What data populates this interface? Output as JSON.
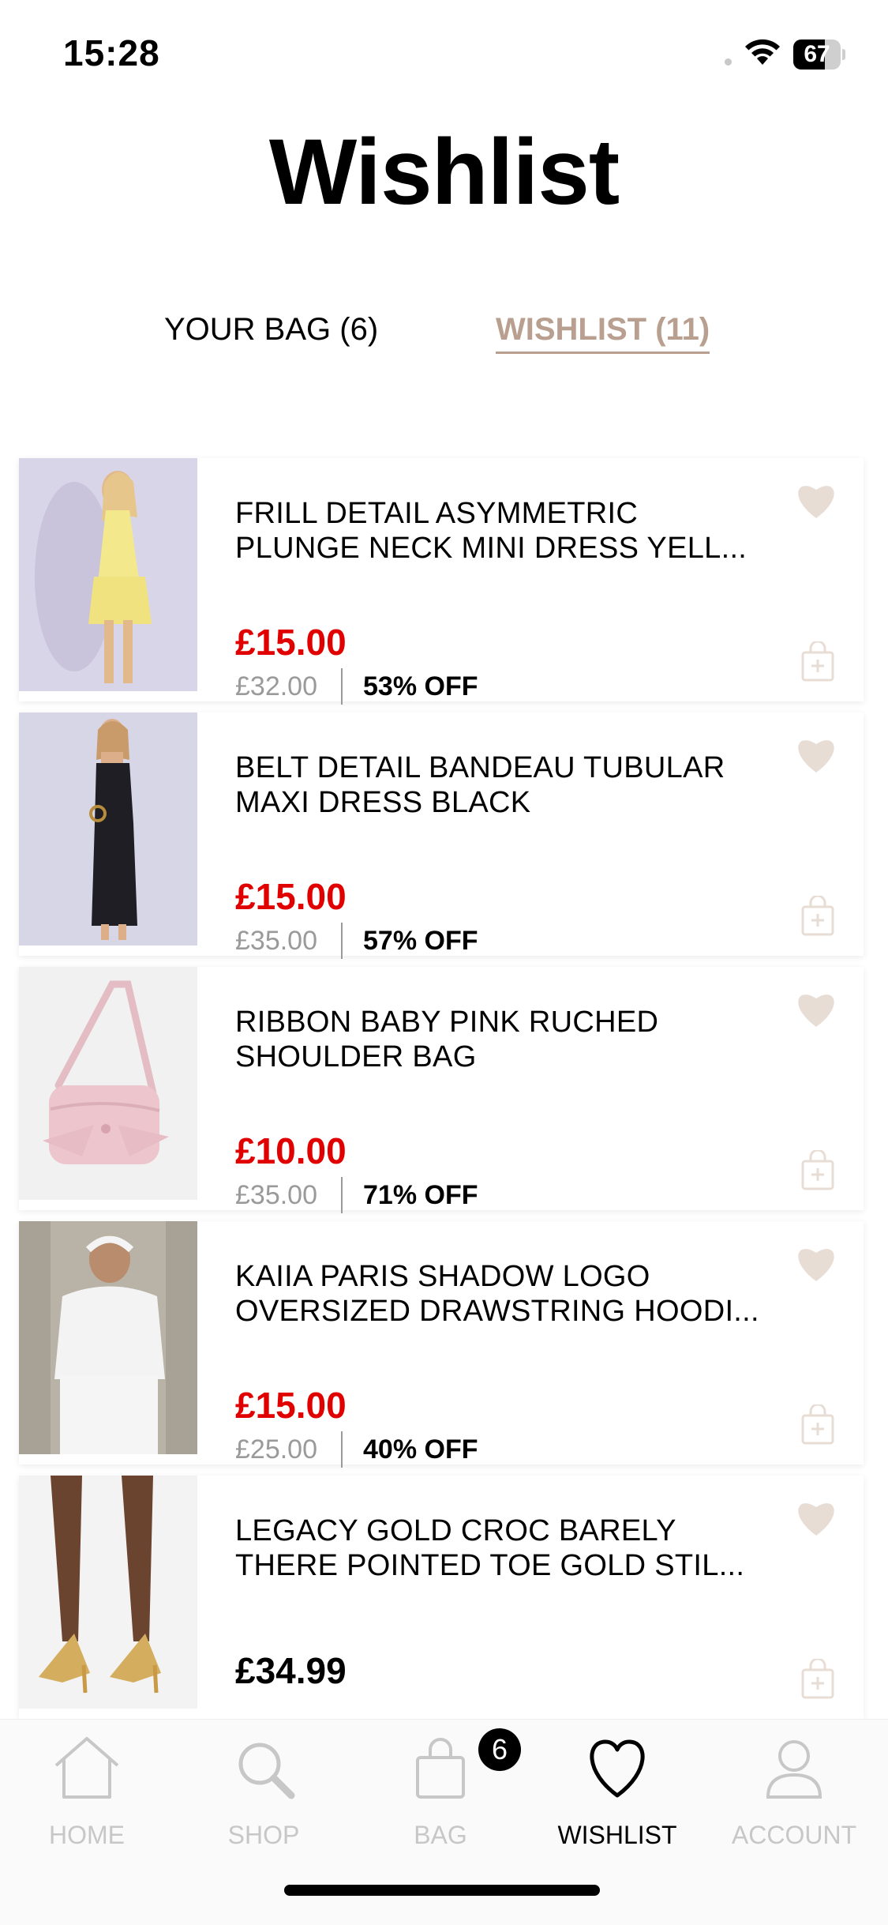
{
  "status_bar": {
    "time": "15:28",
    "battery": "67"
  },
  "header": {
    "title": "Wishlist"
  },
  "tabs": [
    {
      "label": "YOUR BAG (6)",
      "active": false
    },
    {
      "label": "WISHLIST (11)",
      "active": true
    }
  ],
  "colors": {
    "accent": "#b99f8f",
    "sale": "#e00000",
    "wishlist_icon": "#e8ddd5"
  },
  "items": [
    {
      "name_line1": "FRILL DETAIL ASYMMETRIC",
      "name_line2": "PLUNGE NECK MINI DRESS YELL...",
      "price": "£15.00",
      "was_price": "£32.00",
      "discount": "53% OFF",
      "image_icon": "yellow-frill-dress-photo"
    },
    {
      "name_line1": "BELT DETAIL BANDEAU TUBULAR",
      "name_line2": "MAXI DRESS BLACK",
      "price": "£15.00",
      "was_price": "£35.00",
      "discount": "57% OFF",
      "image_icon": "black-maxi-dress-photo"
    },
    {
      "name_line1": "RIBBON BABY PINK RUCHED",
      "name_line2": "SHOULDER BAG",
      "price": "£10.00",
      "was_price": "£35.00",
      "discount": "71% OFF",
      "image_icon": "pink-shoulder-bag-photo"
    },
    {
      "name_line1": "KAIIA PARIS SHADOW LOGO",
      "name_line2": "OVERSIZED DRAWSTRING HOODI...",
      "price": "£15.00",
      "was_price": "£25.00",
      "discount": "40% OFF",
      "image_icon": "white-hoodie-photo"
    },
    {
      "name_line1": "LEGACY GOLD CROC BARELY",
      "name_line2": "THERE POINTED TOE GOLD STIL...",
      "price": "£34.99",
      "image_icon": "gold-heels-photo"
    }
  ],
  "tab_bar": {
    "items": [
      {
        "label": "HOME",
        "icon": "home-icon"
      },
      {
        "label": "SHOP",
        "icon": "search-icon"
      },
      {
        "label": "BAG",
        "icon": "bag-icon"
      },
      {
        "label": "WISHLIST",
        "icon": "heart-icon"
      },
      {
        "label": "ACCOUNT",
        "icon": "account-icon"
      }
    ],
    "bag_badge": "6"
  }
}
